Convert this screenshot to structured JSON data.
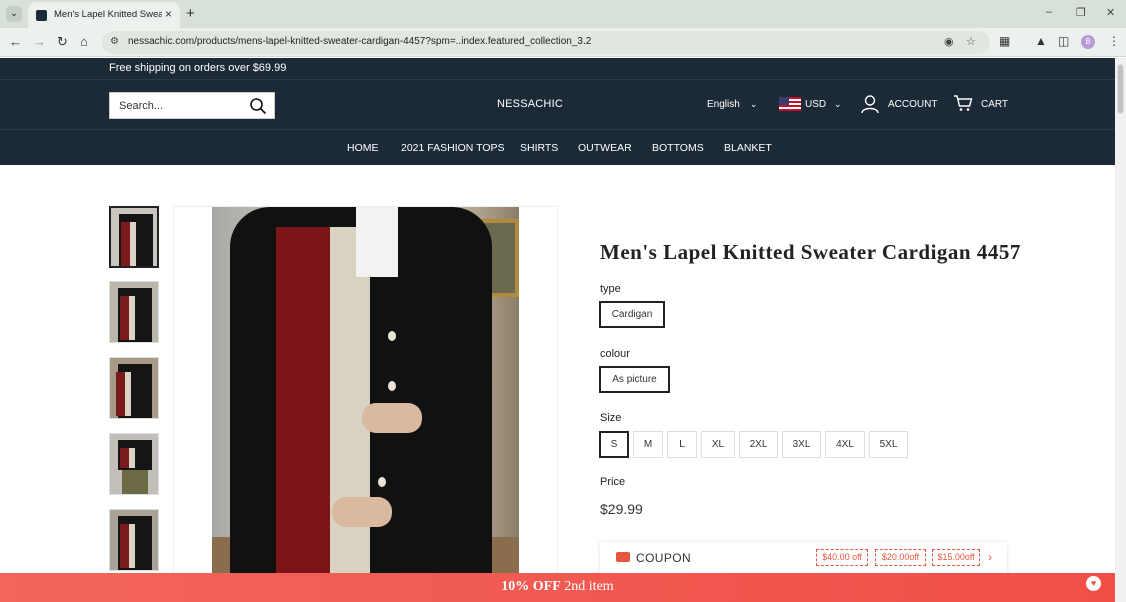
{
  "browser": {
    "tab_title": "Men's Lapel Knitted Sweater Ca",
    "url": "nessachic.com/products/mens-lapel-knitted-sweater-cardigan-4457?spm=..index.featured_collection_3.2",
    "profile_initial": "B"
  },
  "announcement": {
    "text": "Free shipping on orders over $69.99"
  },
  "header": {
    "search_placeholder": "Search...",
    "logo": "NESSACHIC",
    "language": "English",
    "currency": "USD",
    "account_label": "ACCOUNT",
    "cart_label": "CART"
  },
  "nav": {
    "items": [
      {
        "label": "HOME"
      },
      {
        "label": "2021 FASHION TOPS"
      },
      {
        "label": "SHIRTS"
      },
      {
        "label": "OUTWEAR"
      },
      {
        "label": "BOTTOMS"
      },
      {
        "label": "BLANKET"
      }
    ]
  },
  "product": {
    "title": "Men's Lapel Knitted Sweater Cardigan 4457",
    "type": {
      "label": "type",
      "options": [
        "Cardigan"
      ],
      "selected": "Cardigan"
    },
    "colour": {
      "label": "colour",
      "options": [
        "As picture"
      ],
      "selected": "As picture"
    },
    "size": {
      "label": "Size",
      "options": [
        "S",
        "M",
        "L",
        "XL",
        "2XL",
        "3XL",
        "4XL",
        "5XL"
      ],
      "selected": "S"
    },
    "price_label": "Price",
    "price": "$29.99"
  },
  "coupon": {
    "label": "COUPON",
    "chips": [
      "$40.00 off",
      "$20.00off",
      "$15.00off"
    ]
  },
  "promo": {
    "bold": "10% OFF",
    "rest": " 2nd item"
  },
  "colors": {
    "header_bg": "#1c2a38",
    "promo_bg": "#f2655a",
    "coupon_accent": "#e9553e"
  }
}
